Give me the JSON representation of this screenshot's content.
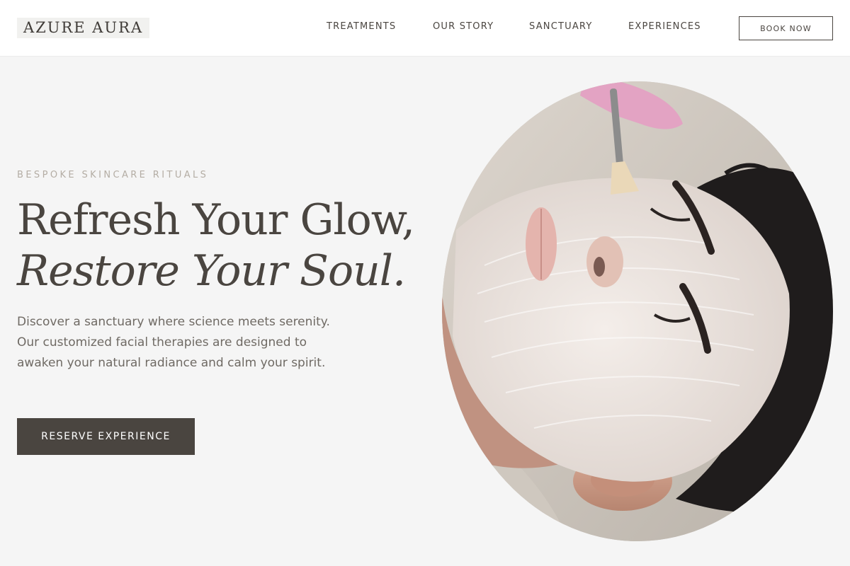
{
  "brand": {
    "name": "AZURE AURA"
  },
  "nav": {
    "items": [
      {
        "label": "TREATMENTS"
      },
      {
        "label": "OUR STORY"
      },
      {
        "label": "SANCTUARY"
      },
      {
        "label": "EXPERIENCES"
      }
    ],
    "book_label": "BOOK NOW"
  },
  "hero": {
    "eyebrow": "BESPOKE SKINCARE RITUALS",
    "headline_line1": "Refresh Your Glow,",
    "headline_line2": "Restore Your Soul.",
    "description": "Discover a sanctuary where science meets serenity. Our customized facial therapies are designed to awaken your natural radiance and calm your spirit.",
    "cta_label": "RESERVE EXPERIENCE"
  },
  "colors": {
    "accent_dark": "#4a4540",
    "page_background": "#f5f5f5",
    "eyebrow": "#b4ada4",
    "body_text": "#6f6a64"
  }
}
